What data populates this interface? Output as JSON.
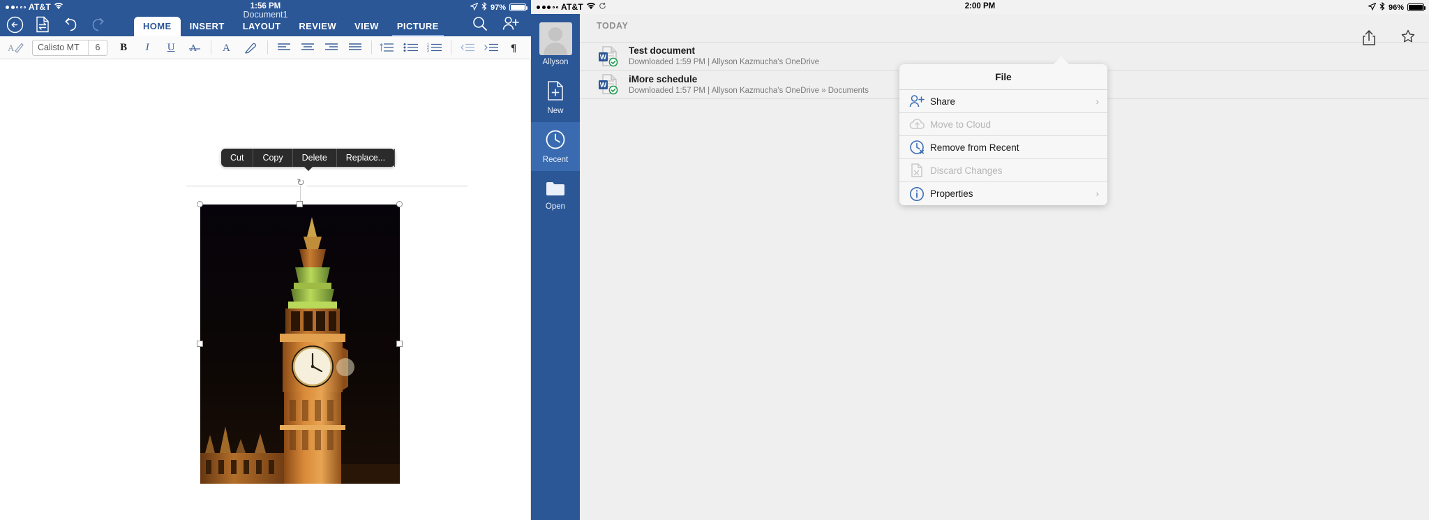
{
  "left": {
    "status": {
      "carrier": "AT&T",
      "signal_dots_filled": 2,
      "signal_dots_total": 5,
      "time": "1:56 PM",
      "battery_percent": "97%",
      "battery_level": 97,
      "location_icon": "location-arrow-icon",
      "bluetooth_icon": "bluetooth-icon",
      "wifi_icon": "wifi-icon"
    },
    "document_title": "Document1",
    "nav_icons": [
      {
        "name": "back-icon",
        "glyph": "back"
      },
      {
        "name": "file-icon",
        "glyph": "file"
      },
      {
        "name": "undo-icon",
        "glyph": "undo"
      },
      {
        "name": "redo-icon",
        "glyph": "redo"
      }
    ],
    "tabs": [
      {
        "label": "HOME",
        "active": true
      },
      {
        "label": "INSERT",
        "active": false
      },
      {
        "label": "LAYOUT",
        "active": false
      },
      {
        "label": "REVIEW",
        "active": false
      },
      {
        "label": "VIEW",
        "active": false
      },
      {
        "label": "PICTURE",
        "active": false,
        "contextual": true
      }
    ],
    "header_actions": [
      {
        "name": "search-icon",
        "label": "Search"
      },
      {
        "name": "add-person-icon",
        "label": "Share"
      }
    ],
    "format_bar": {
      "format_painter_icon": "format-painter-icon",
      "font_name": "Calisto MT",
      "font_size": "6",
      "bold_label": "B",
      "italic_label": "I",
      "underline_label": "U",
      "strikethrough_label": "A",
      "font_color_label": "A",
      "highlight_icon": "highlighter-icon",
      "align_left_icon": "align-left-icon",
      "align_center_icon": "align-center-icon",
      "align_right_icon": "align-right-icon",
      "align_justify_icon": "align-justify-icon",
      "line_spacing_icon": "line-spacing-icon",
      "bullet_list_icon": "bullet-list-icon",
      "numbered_list_icon": "numbered-list-icon",
      "outdent_icon": "outdent-icon",
      "indent_icon": "indent-icon",
      "pilcrow_icon": "pilcrow-icon"
    },
    "context_menu": {
      "items": [
        {
          "label": "Cut"
        },
        {
          "label": "Copy"
        },
        {
          "label": "Delete"
        },
        {
          "label": "Replace..."
        }
      ]
    },
    "image": {
      "name": "big-ben-photo",
      "rotate_handle_icon": "rotate-icon"
    }
  },
  "right": {
    "status": {
      "carrier": "AT&T",
      "signal_dots_filled": 3,
      "signal_dots_total": 5,
      "time": "2:00 PM",
      "battery_percent": "96%",
      "battery_level": 96,
      "location_icon": "location-arrow-icon",
      "bluetooth_icon": "bluetooth-icon",
      "wifi_icon": "wifi-icon"
    },
    "sidebar": {
      "account_name": "Allyson",
      "items": [
        {
          "label": "New",
          "icon": "new-document-icon",
          "active": false
        },
        {
          "label": "Recent",
          "icon": "clock-icon",
          "active": true
        },
        {
          "label": "Open",
          "icon": "folder-icon",
          "active": false
        }
      ]
    },
    "section_header": "TODAY",
    "topbar_actions": [
      {
        "name": "share-icon",
        "label": "Share"
      },
      {
        "name": "pin-icon",
        "label": "Pin"
      }
    ],
    "files": [
      {
        "name": "Test document",
        "subtitle": "Downloaded 1:59 PM | Allyson Kazmucha's OneDrive",
        "icon": "word-document-icon",
        "synced": true
      },
      {
        "name": "iMore schedule",
        "subtitle": "Downloaded 1:57 PM | Allyson Kazmucha's OneDrive » Documents",
        "icon": "word-document-icon",
        "synced": true
      }
    ],
    "popover": {
      "title": "File",
      "items": [
        {
          "label": "Share",
          "icon": "person-share-icon",
          "disabled": false,
          "chevron": true
        },
        {
          "label": "Move to Cloud",
          "icon": "cloud-upload-icon",
          "disabled": true,
          "chevron": false
        },
        {
          "label": "Remove from Recent",
          "icon": "clock-remove-icon",
          "disabled": false,
          "chevron": false
        },
        {
          "label": "Discard Changes",
          "icon": "discard-icon",
          "disabled": true,
          "chevron": false
        },
        {
          "label": "Properties",
          "icon": "info-icon",
          "disabled": false,
          "chevron": true
        }
      ]
    }
  },
  "colors": {
    "word_blue": "#2b5797",
    "word_blue_light": "#3a6bb0",
    "context_menu_bg": "#2b2b2b",
    "panel_bg": "#efefef"
  }
}
